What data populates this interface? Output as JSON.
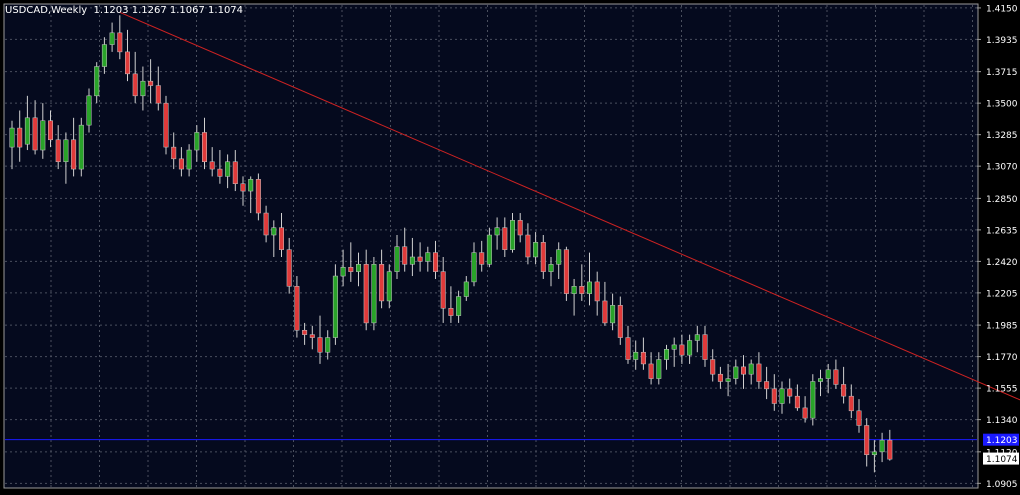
{
  "header": {
    "symbol_timeframe": "USDCAD,Weekly",
    "ohlc_text": "1.1203 1.1267 1.1067 1.1074"
  },
  "chart_data": {
    "type": "candlestick",
    "grid": true,
    "background_color": "#050a1e",
    "bull_color": "#29a329",
    "bear_color": "#e03a3a",
    "wick_color": "#d0d0d0",
    "y_axis": {
      "ylim": [
        1.088,
        1.417
      ],
      "tick_labels": [
        "1.4150",
        "1.3935",
        "1.3715",
        "1.3500",
        "1.3285",
        "1.3070",
        "1.2850",
        "1.2635",
        "1.2420",
        "1.2205",
        "1.1985",
        "1.1770",
        "1.1555",
        "1.1340",
        "1.1120",
        "1.0905"
      ],
      "tick_values": [
        1.415,
        1.3935,
        1.3715,
        1.35,
        1.3285,
        1.307,
        1.285,
        1.2635,
        1.242,
        1.2205,
        1.1985,
        1.177,
        1.1555,
        1.134,
        1.112,
        1.0905
      ]
    },
    "horizontal_line": {
      "value": 1.1203,
      "label": "1.1203",
      "color": "#1a1aff"
    },
    "current_price": {
      "value": 1.1074,
      "label": "1.1074"
    },
    "trend_line": {
      "from_bar": 14,
      "from_price": 1.412,
      "to_bar": 134,
      "to_price": 1.1405,
      "color": "#cc2222"
    },
    "candles": [
      [
        1.32,
        1.338,
        1.305,
        1.333
      ],
      [
        1.333,
        1.345,
        1.31,
        1.32
      ],
      [
        1.322,
        1.355,
        1.318,
        1.34
      ],
      [
        1.34,
        1.352,
        1.315,
        1.318
      ],
      [
        1.318,
        1.35,
        1.312,
        1.338
      ],
      [
        1.338,
        1.345,
        1.32,
        1.325
      ],
      [
        1.325,
        1.335,
        1.305,
        1.31
      ],
      [
        1.31,
        1.33,
        1.295,
        1.325
      ],
      [
        1.325,
        1.34,
        1.3,
        1.305
      ],
      [
        1.305,
        1.34,
        1.3,
        1.335
      ],
      [
        1.335,
        1.36,
        1.33,
        1.355
      ],
      [
        1.355,
        1.378,
        1.35,
        1.375
      ],
      [
        1.375,
        1.395,
        1.37,
        1.39
      ],
      [
        1.39,
        1.405,
        1.385,
        1.398
      ],
      [
        1.398,
        1.41,
        1.38,
        1.385
      ],
      [
        1.385,
        1.4,
        1.365,
        1.37
      ],
      [
        1.37,
        1.385,
        1.35,
        1.355
      ],
      [
        1.355,
        1.375,
        1.345,
        1.365
      ],
      [
        1.365,
        1.38,
        1.35,
        1.362
      ],
      [
        1.362,
        1.375,
        1.345,
        1.35
      ],
      [
        1.35,
        1.355,
        1.315,
        1.32
      ],
      [
        1.32,
        1.33,
        1.305,
        1.312
      ],
      [
        1.312,
        1.32,
        1.3,
        1.305
      ],
      [
        1.305,
        1.322,
        1.3,
        1.318
      ],
      [
        1.318,
        1.335,
        1.31,
        1.33
      ],
      [
        1.33,
        1.34,
        1.305,
        1.31
      ],
      [
        1.31,
        1.32,
        1.3,
        1.305
      ],
      [
        1.305,
        1.318,
        1.295,
        1.3
      ],
      [
        1.3,
        1.315,
        1.292,
        1.31
      ],
      [
        1.31,
        1.318,
        1.29,
        1.295
      ],
      [
        1.295,
        1.3,
        1.28,
        1.29
      ],
      [
        1.29,
        1.3,
        1.275,
        1.298
      ],
      [
        1.298,
        1.302,
        1.27,
        1.275
      ],
      [
        1.275,
        1.28,
        1.255,
        1.26
      ],
      [
        1.26,
        1.27,
        1.245,
        1.265
      ],
      [
        1.265,
        1.275,
        1.245,
        1.25
      ],
      [
        1.25,
        1.258,
        1.22,
        1.225
      ],
      [
        1.225,
        1.232,
        1.19,
        1.195
      ],
      [
        1.195,
        1.2,
        1.185,
        1.192
      ],
      [
        1.192,
        1.198,
        1.182,
        1.19
      ],
      [
        1.19,
        1.205,
        1.172,
        1.18
      ],
      [
        1.18,
        1.195,
        1.175,
        1.19
      ],
      [
        1.19,
        1.24,
        1.185,
        1.232
      ],
      [
        1.232,
        1.25,
        1.225,
        1.238
      ],
      [
        1.238,
        1.255,
        1.228,
        1.235
      ],
      [
        1.235,
        1.248,
        1.225,
        1.24
      ],
      [
        1.24,
        1.25,
        1.195,
        1.2
      ],
      [
        1.2,
        1.245,
        1.195,
        1.24
      ],
      [
        1.24,
        1.25,
        1.21,
        1.215
      ],
      [
        1.215,
        1.24,
        1.21,
        1.235
      ],
      [
        1.235,
        1.26,
        1.23,
        1.252
      ],
      [
        1.252,
        1.265,
        1.235,
        1.24
      ],
      [
        1.24,
        1.258,
        1.232,
        1.245
      ],
      [
        1.245,
        1.255,
        1.235,
        1.242
      ],
      [
        1.242,
        1.252,
        1.235,
        1.248
      ],
      [
        1.248,
        1.256,
        1.23,
        1.235
      ],
      [
        1.235,
        1.245,
        1.2,
        1.21
      ],
      [
        1.21,
        1.225,
        1.2,
        1.205
      ],
      [
        1.205,
        1.222,
        1.2,
        1.218
      ],
      [
        1.218,
        1.232,
        1.215,
        1.228
      ],
      [
        1.228,
        1.255,
        1.225,
        1.248
      ],
      [
        1.248,
        1.256,
        1.235,
        1.24
      ],
      [
        1.24,
        1.265,
        1.238,
        1.26
      ],
      [
        1.26,
        1.272,
        1.25,
        1.265
      ],
      [
        1.265,
        1.272,
        1.245,
        1.25
      ],
      [
        1.25,
        1.275,
        1.248,
        1.27
      ],
      [
        1.27,
        1.275,
        1.255,
        1.26
      ],
      [
        1.26,
        1.268,
        1.24,
        1.245
      ],
      [
        1.245,
        1.262,
        1.24,
        1.255
      ],
      [
        1.255,
        1.26,
        1.23,
        1.235
      ],
      [
        1.235,
        1.245,
        1.225,
        1.24
      ],
      [
        1.24,
        1.255,
        1.23,
        1.25
      ],
      [
        1.25,
        1.252,
        1.215,
        1.22
      ],
      [
        1.22,
        1.23,
        1.205,
        1.225
      ],
      [
        1.225,
        1.24,
        1.215,
        1.22
      ],
      [
        1.22,
        1.248,
        1.212,
        1.228
      ],
      [
        1.228,
        1.235,
        1.205,
        1.215
      ],
      [
        1.215,
        1.228,
        1.198,
        1.2
      ],
      [
        1.2,
        1.22,
        1.195,
        1.212
      ],
      [
        1.212,
        1.218,
        1.185,
        1.19
      ],
      [
        1.19,
        1.198,
        1.172,
        1.175
      ],
      [
        1.175,
        1.188,
        1.168,
        1.18
      ],
      [
        1.18,
        1.19,
        1.168,
        1.172
      ],
      [
        1.172,
        1.18,
        1.158,
        1.162
      ],
      [
        1.162,
        1.18,
        1.158,
        1.175
      ],
      [
        1.175,
        1.185,
        1.168,
        1.182
      ],
      [
        1.182,
        1.19,
        1.17,
        1.185
      ],
      [
        1.185,
        1.192,
        1.172,
        1.178
      ],
      [
        1.178,
        1.192,
        1.172,
        1.188
      ],
      [
        1.188,
        1.198,
        1.18,
        1.192
      ],
      [
        1.192,
        1.198,
        1.17,
        1.175
      ],
      [
        1.175,
        1.182,
        1.16,
        1.165
      ],
      [
        1.165,
        1.17,
        1.155,
        1.16
      ],
      [
        1.16,
        1.172,
        1.15,
        1.162
      ],
      [
        1.162,
        1.175,
        1.158,
        1.17
      ],
      [
        1.17,
        1.178,
        1.155,
        1.165
      ],
      [
        1.165,
        1.175,
        1.158,
        1.172
      ],
      [
        1.172,
        1.18,
        1.155,
        1.16
      ],
      [
        1.16,
        1.17,
        1.148,
        1.155
      ],
      [
        1.155,
        1.165,
        1.14,
        1.145
      ],
      [
        1.145,
        1.16,
        1.138,
        1.155
      ],
      [
        1.155,
        1.162,
        1.145,
        1.15
      ],
      [
        1.15,
        1.158,
        1.14,
        1.142
      ],
      [
        1.142,
        1.15,
        1.132,
        1.135
      ],
      [
        1.135,
        1.165,
        1.13,
        1.16
      ],
      [
        1.16,
        1.168,
        1.15,
        1.162
      ],
      [
        1.162,
        1.172,
        1.152,
        1.168
      ],
      [
        1.168,
        1.175,
        1.155,
        1.158
      ],
      [
        1.158,
        1.17,
        1.145,
        1.15
      ],
      [
        1.15,
        1.158,
        1.135,
        1.14
      ],
      [
        1.14,
        1.148,
        1.125,
        1.13
      ],
      [
        1.13,
        1.135,
        1.102,
        1.11
      ],
      [
        1.11,
        1.12,
        1.098,
        1.112
      ],
      [
        1.112,
        1.125,
        1.105,
        1.12
      ],
      [
        1.12,
        1.127,
        1.106,
        1.107
      ]
    ]
  }
}
